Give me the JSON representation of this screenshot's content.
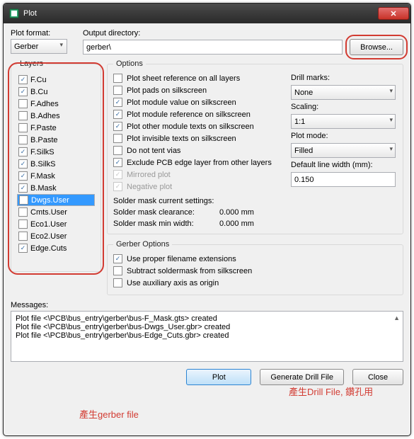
{
  "window": {
    "title": "Plot",
    "close": "X"
  },
  "format": {
    "label": "Plot format:",
    "value": "Gerber"
  },
  "outdir": {
    "label": "Output directory:",
    "value": "gerber\\",
    "browse": "Browse..."
  },
  "layers": {
    "legend": "Layers",
    "items": [
      {
        "label": "F.Cu",
        "checked": true
      },
      {
        "label": "B.Cu",
        "checked": true
      },
      {
        "label": "F.Adhes",
        "checked": false
      },
      {
        "label": "B.Adhes",
        "checked": false
      },
      {
        "label": "F.Paste",
        "checked": false
      },
      {
        "label": "B.Paste",
        "checked": false
      },
      {
        "label": "F.SilkS",
        "checked": true
      },
      {
        "label": "B.SilkS",
        "checked": true
      },
      {
        "label": "F.Mask",
        "checked": true
      },
      {
        "label": "B.Mask",
        "checked": true
      },
      {
        "label": "Dwgs.User",
        "checked": false,
        "selected": true
      },
      {
        "label": "Cmts.User",
        "checked": false
      },
      {
        "label": "Eco1.User",
        "checked": false
      },
      {
        "label": "Eco2.User",
        "checked": false
      },
      {
        "label": "Edge.Cuts",
        "checked": true
      }
    ]
  },
  "options": {
    "legend": "Options",
    "items": [
      {
        "label": "Plot sheet reference on all layers",
        "checked": false
      },
      {
        "label": "Plot pads on silkscreen",
        "checked": false
      },
      {
        "label": "Plot module value on silkscreen",
        "checked": true
      },
      {
        "label": "Plot module reference on silkscreen",
        "checked": true
      },
      {
        "label": "Plot other module texts on silkscreen",
        "checked": true
      },
      {
        "label": "Plot invisible texts on silkscreen",
        "checked": false
      },
      {
        "label": "Do not tent vias",
        "checked": false
      },
      {
        "label": "Exclude PCB edge layer from other layers",
        "checked": true
      },
      {
        "label": "Mirrored plot",
        "checked": false,
        "disabled": true
      },
      {
        "label": "Negative plot",
        "checked": false,
        "disabled": true
      }
    ],
    "drill": {
      "label": "Drill marks:",
      "value": "None"
    },
    "scaling": {
      "label": "Scaling:",
      "value": "1:1"
    },
    "mode": {
      "label": "Plot mode:",
      "value": "Filled"
    },
    "linewidth": {
      "label": "Default line width (mm):",
      "value": "0.150"
    }
  },
  "solder": {
    "legend": "Solder mask current settings:",
    "clearance": {
      "label": "Solder mask clearance:",
      "value": "0.000 mm"
    },
    "minwidth": {
      "label": "Solder mask min width:",
      "value": "0.000 mm"
    }
  },
  "gerber": {
    "legend": "Gerber Options",
    "items": [
      {
        "label": "Use proper filename extensions",
        "checked": true
      },
      {
        "label": "Subtract soldermask from silkscreen",
        "checked": false
      },
      {
        "label": "Use auxiliary axis as origin",
        "checked": false
      }
    ]
  },
  "messages": {
    "label": "Messages:",
    "lines": [
      "Plot file <\\PCB\\bus_entry\\gerber\\bus-F_Mask.gts> created",
      "Plot file <\\PCB\\bus_entry\\gerber\\bus-Dwgs_User.gbr> created",
      "Plot file <\\PCB\\bus_entry\\gerber\\bus-Edge_Cuts.gbr> created"
    ]
  },
  "footer": {
    "plot": "Plot",
    "drill": "Generate Drill File",
    "close": "Close"
  },
  "annot": {
    "gerber": "產生gerber file",
    "drill": "產生Drill File, 鑽孔用"
  }
}
